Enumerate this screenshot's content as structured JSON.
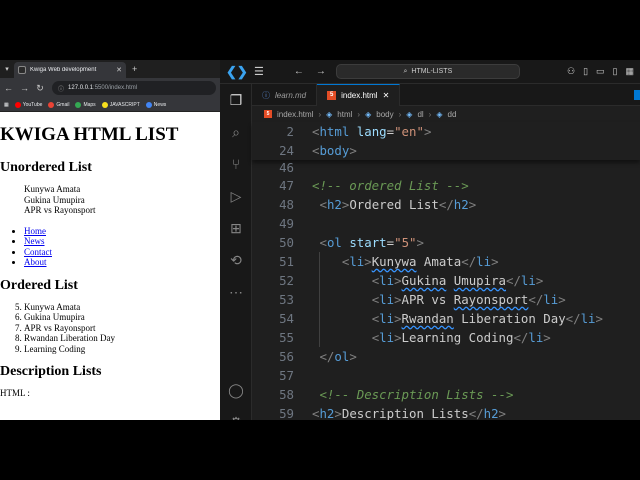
{
  "browser": {
    "tab_title": "Kwiga Web development",
    "url_host": "127.0.0.1",
    "url_path": ":5500/index.html",
    "bookmarks": [
      {
        "label": "YouTube",
        "color": "#ff0000"
      },
      {
        "label": "Gmail",
        "color": "#ea4335"
      },
      {
        "label": "Maps",
        "color": "#34a853"
      },
      {
        "label": "JAVASCRIPT",
        "color": "#f7df1e"
      },
      {
        "label": "News",
        "color": "#4285f4"
      }
    ],
    "page": {
      "h1": "KWIGA HTML LIST",
      "unordered_heading": "Unordered List",
      "unordered_items": [
        "Kunywa Amata",
        "Gukina Umupira",
        "APR vs Rayonsport"
      ],
      "link_items": [
        "Home",
        "News",
        "Contact",
        "About"
      ],
      "ordered_heading": "Ordered List",
      "ordered_start": 5,
      "ordered_items": [
        "Kunywa Amata",
        "Gukina Umupira",
        "APR vs Rayonsport",
        "Rwandan Liberation Day",
        "Learning Coding"
      ],
      "description_heading": "Description Lists",
      "description_first_term": "HTML :"
    }
  },
  "vscode": {
    "search_text": "HTML-LISTS",
    "tabs": [
      {
        "label": "learn.md",
        "active": false
      },
      {
        "label": "index.html",
        "active": true
      }
    ],
    "breadcrumb": [
      "index.html",
      "html",
      "body",
      "dl",
      "dd"
    ],
    "activity_icons": [
      "explorer-icon",
      "search-icon",
      "source-control-icon",
      "run-debug-icon",
      "extensions-icon",
      "remote-explorer-icon",
      "more-icon",
      "account-icon",
      "settings-gear-icon"
    ],
    "editor_lines": [
      {
        "num": "2",
        "text": "<html lang=\"en\">"
      },
      {
        "num": "24",
        "text": "<body>"
      },
      {
        "num": "46",
        "text": ""
      },
      {
        "num": "47",
        "text": "<!-- ordered List -->"
      },
      {
        "num": "48",
        "text": " <h2>Ordered List</h2>"
      },
      {
        "num": "49",
        "text": ""
      },
      {
        "num": "50",
        "text": " <ol start=\"5\">"
      },
      {
        "num": "51",
        "text": "    <li>Kunywa Amata</li>"
      },
      {
        "num": "52",
        "text": "        <li>Gukina Umupira</li>"
      },
      {
        "num": "53",
        "text": "        <li>APR vs Rayonsport</li>"
      },
      {
        "num": "54",
        "text": "        <li>Rwandan Liberation Day</li>"
      },
      {
        "num": "55",
        "text": "        <li>Learning Coding</li>"
      },
      {
        "num": "56",
        "text": " </ol>"
      },
      {
        "num": "57",
        "text": ""
      },
      {
        "num": "58",
        "text": " <!-- Description Lists -->"
      },
      {
        "num": "59",
        "text": "<h2>Description Lists</h2>"
      }
    ]
  }
}
